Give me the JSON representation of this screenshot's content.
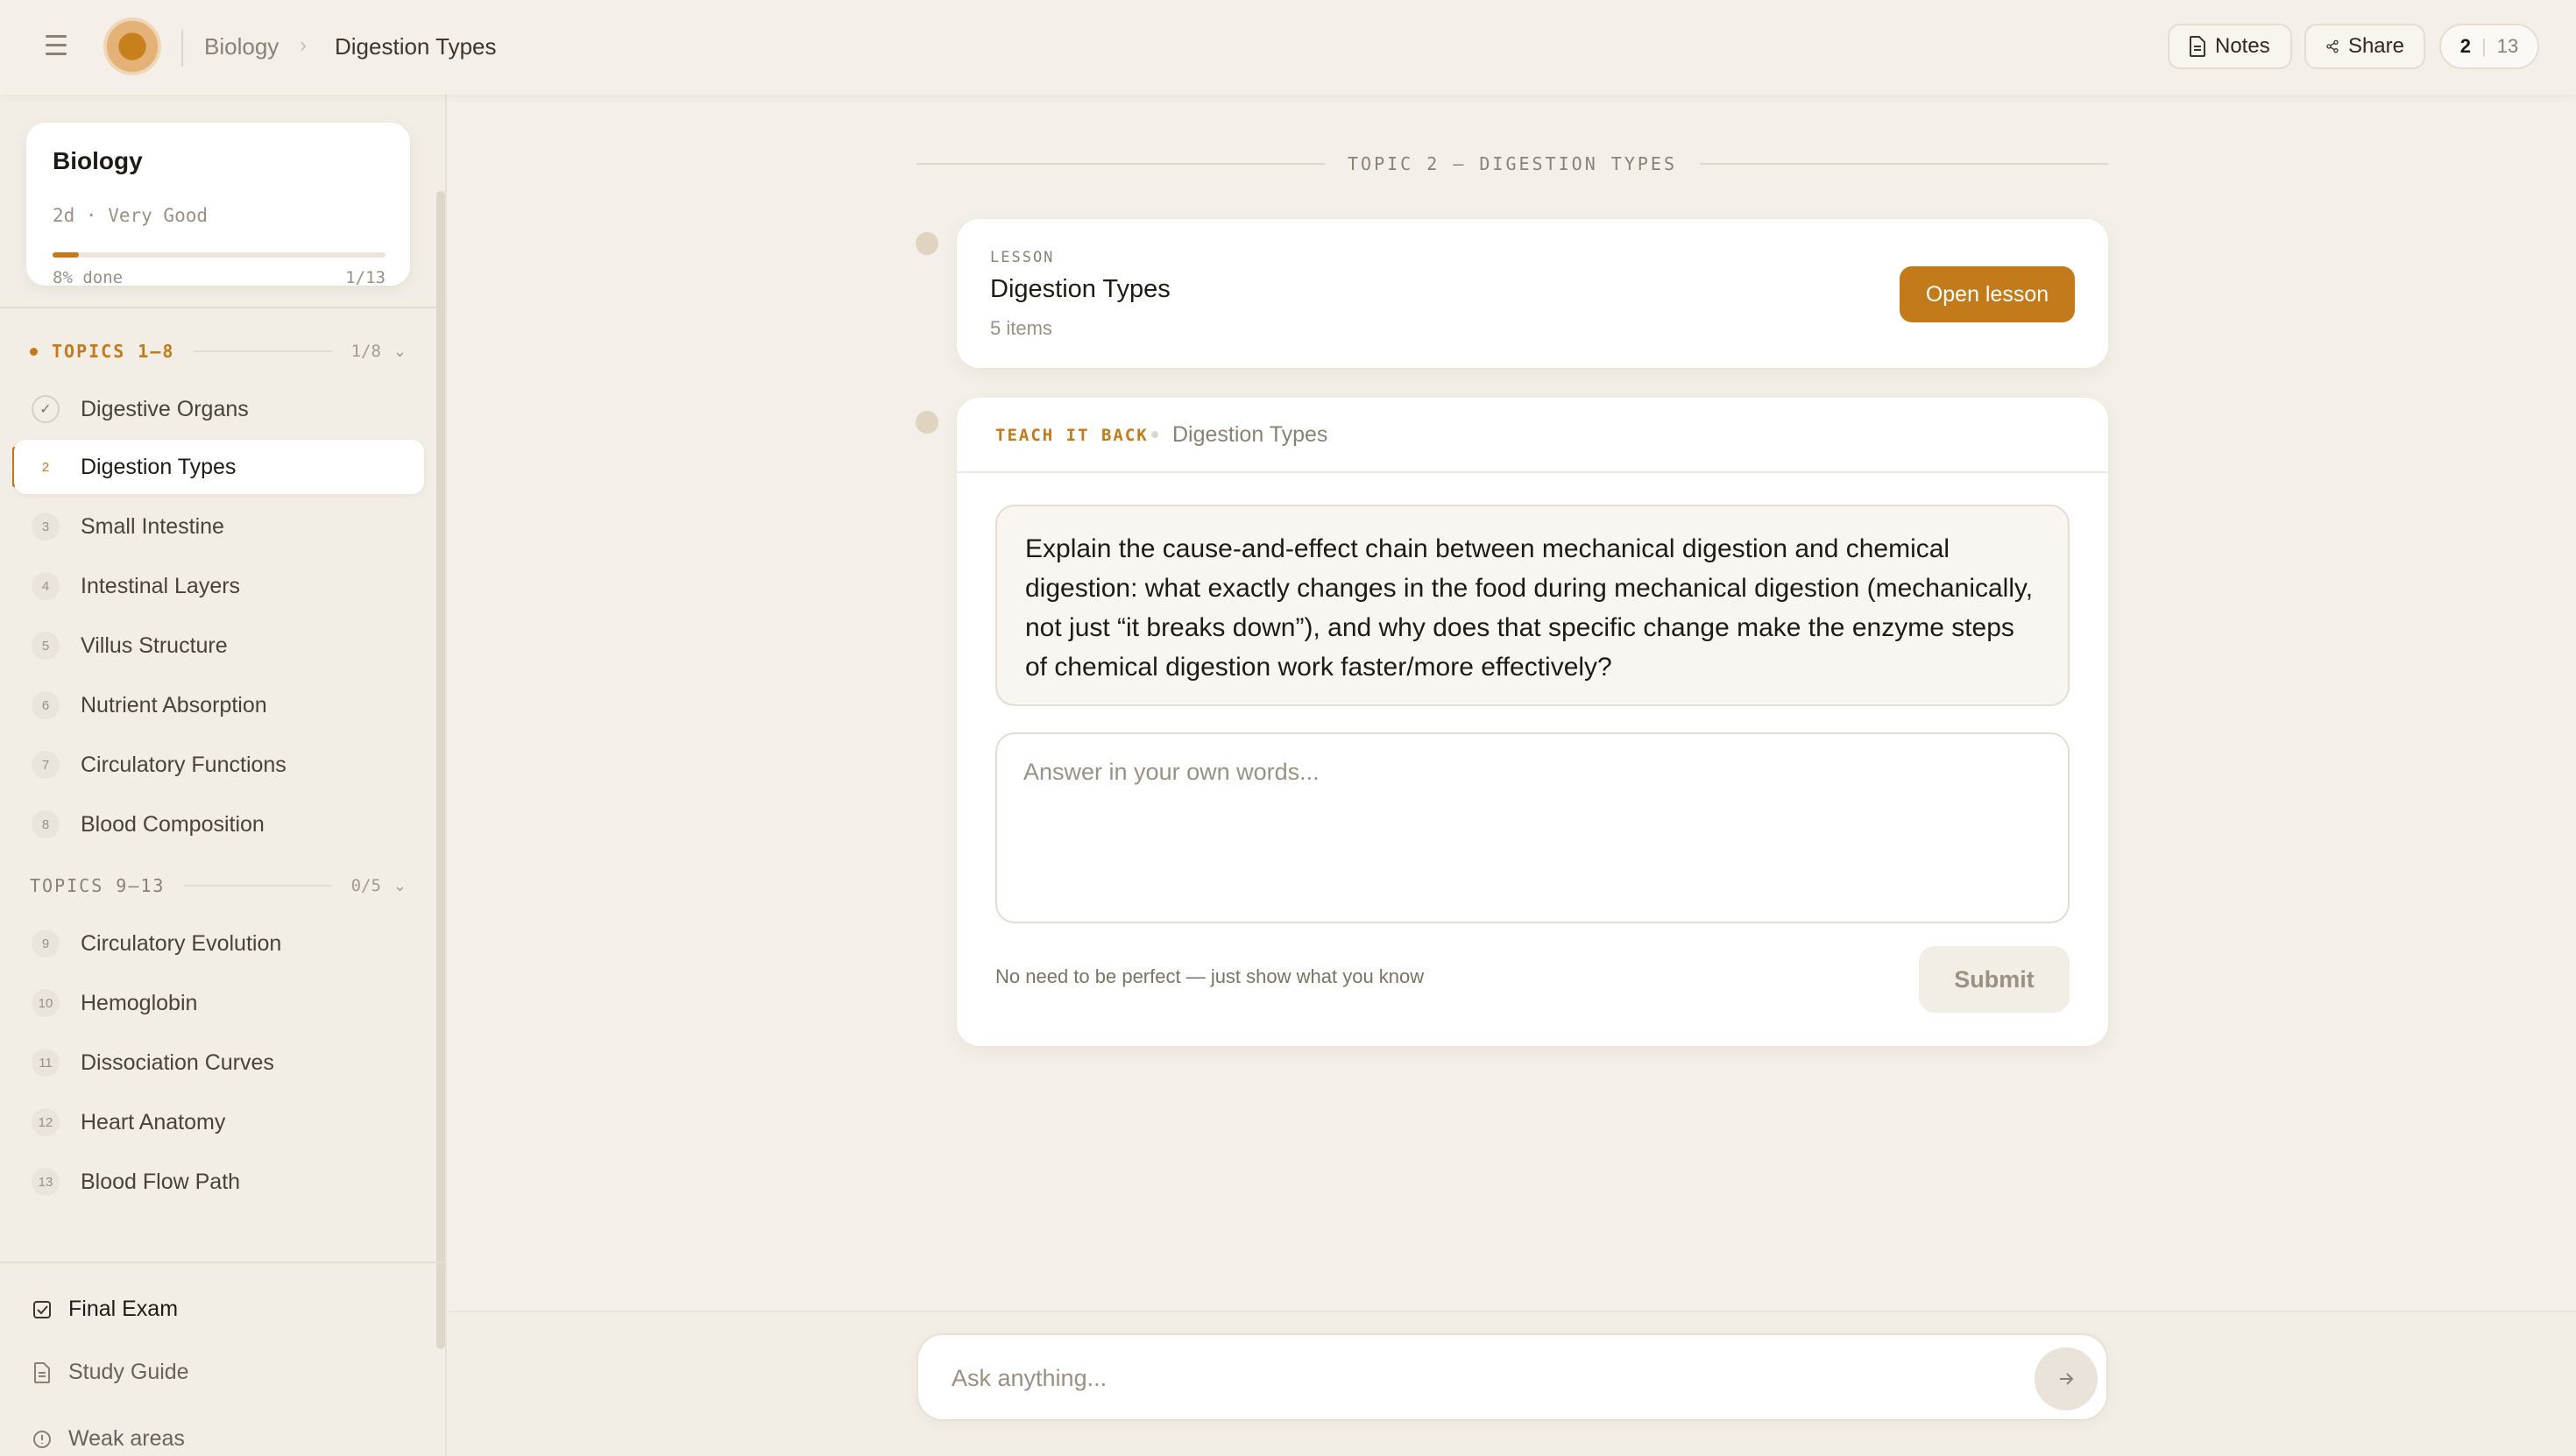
{
  "header": {
    "breadcrumb_root": "Biology",
    "breadcrumb_sep": "›",
    "breadcrumb_current": "Digestion Types",
    "notes_label": "Notes",
    "share_label": "Share",
    "counter_current": "2",
    "counter_sep": "|",
    "counter_total": "13"
  },
  "sidebar": {
    "course": {
      "title": "Biology",
      "meta": "2d · Very Good",
      "progress_fraction": 0.08,
      "done_label": "8% done",
      "count_label": "1/13"
    },
    "groups": [
      {
        "title": "TOPICS 1–8",
        "count": "1/8",
        "topics": [
          {
            "num": "✓",
            "label": "Digestive Organs"
          },
          {
            "num": "2",
            "label": "Digestion Types"
          },
          {
            "num": "3",
            "label": "Small Intestine"
          },
          {
            "num": "4",
            "label": "Intestinal Layers"
          },
          {
            "num": "5",
            "label": "Villus Structure"
          },
          {
            "num": "6",
            "label": "Nutrient Absorption"
          },
          {
            "num": "7",
            "label": "Circulatory Functions"
          },
          {
            "num": "8",
            "label": "Blood Composition"
          }
        ]
      },
      {
        "title": "TOPICS 9–13",
        "count": "0/5",
        "topics": [
          {
            "num": "9",
            "label": "Circulatory Evolution"
          },
          {
            "num": "10",
            "label": "Hemoglobin"
          },
          {
            "num": "11",
            "label": "Dissociation Curves"
          },
          {
            "num": "12",
            "label": "Heart Anatomy"
          },
          {
            "num": "13",
            "label": "Blood Flow Path"
          }
        ]
      }
    ],
    "links": [
      {
        "label": "Final Exam",
        "icon": "checkbox-icon"
      },
      {
        "label": "Study Guide",
        "icon": "document-icon"
      },
      {
        "label": "Weak areas",
        "icon": "alert-icon"
      }
    ]
  },
  "main": {
    "section_title": "TOPIC 2 — DIGESTION TYPES",
    "lesson": {
      "kicker": "LESSON",
      "title": "Digestion Types",
      "items": "5 items",
      "open_label": "Open lesson"
    },
    "teach": {
      "kicker": "TEACH IT BACK",
      "topic": "Digestion Types",
      "question": "Explain the cause-and-effect chain between mechanical digestion and chemical digestion: what exactly changes in the food during mechanical digestion (mechanically, not just “it breaks down”), and why does that specific change make the enzyme steps of chemical digestion work faster/more effectively?",
      "answer_placeholder": "Answer in your own words...",
      "answer_value": "",
      "hint": "No need to be perfect — just show what you know",
      "submit_label": "Submit"
    },
    "ask": {
      "placeholder": "Ask anything..."
    }
  },
  "colors": {
    "accent": "#c27a1b",
    "background": "#f4f0e9",
    "card": "#ffffff"
  }
}
